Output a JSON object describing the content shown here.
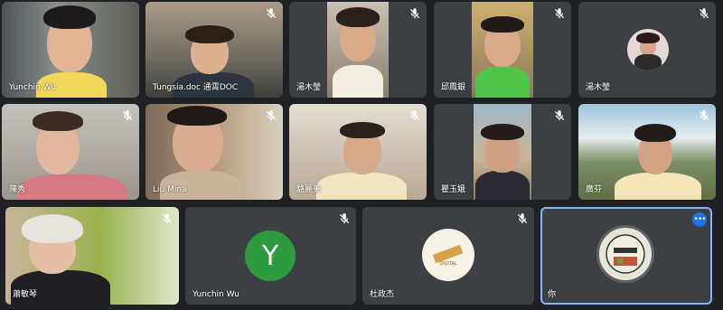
{
  "participants": [
    {
      "name": "Yunchin Wu",
      "muted": false
    },
    {
      "name": "Tungsia.doc 通霄DOC",
      "muted": true
    },
    {
      "name": "湯木瑩",
      "muted": true
    },
    {
      "name": "邱鳳銀",
      "muted": true
    },
    {
      "name": "湯木瑩",
      "muted": true
    },
    {
      "name": "陳秀",
      "muted": true
    },
    {
      "name": "Liu Mina",
      "muted": true
    },
    {
      "name": "駱麗美",
      "muted": true
    },
    {
      "name": "瞿玉娥",
      "muted": true
    },
    {
      "name": "廣芬",
      "muted": true
    },
    {
      "name": "蕭敏琴",
      "muted": true
    },
    {
      "name": "Yunchin Wu",
      "muted": true,
      "avatar_letter": "Y",
      "avatar_color": "#2e9b3f"
    },
    {
      "name": "杜政杰",
      "muted": true,
      "avatar_text": "DIGITAL"
    },
    {
      "name": "你",
      "muted": false
    }
  ],
  "more_options_icon": "more-horiz-icon",
  "colors": {
    "background": "#202124",
    "tile": "#3c4043",
    "accent": "#1a73e8"
  }
}
